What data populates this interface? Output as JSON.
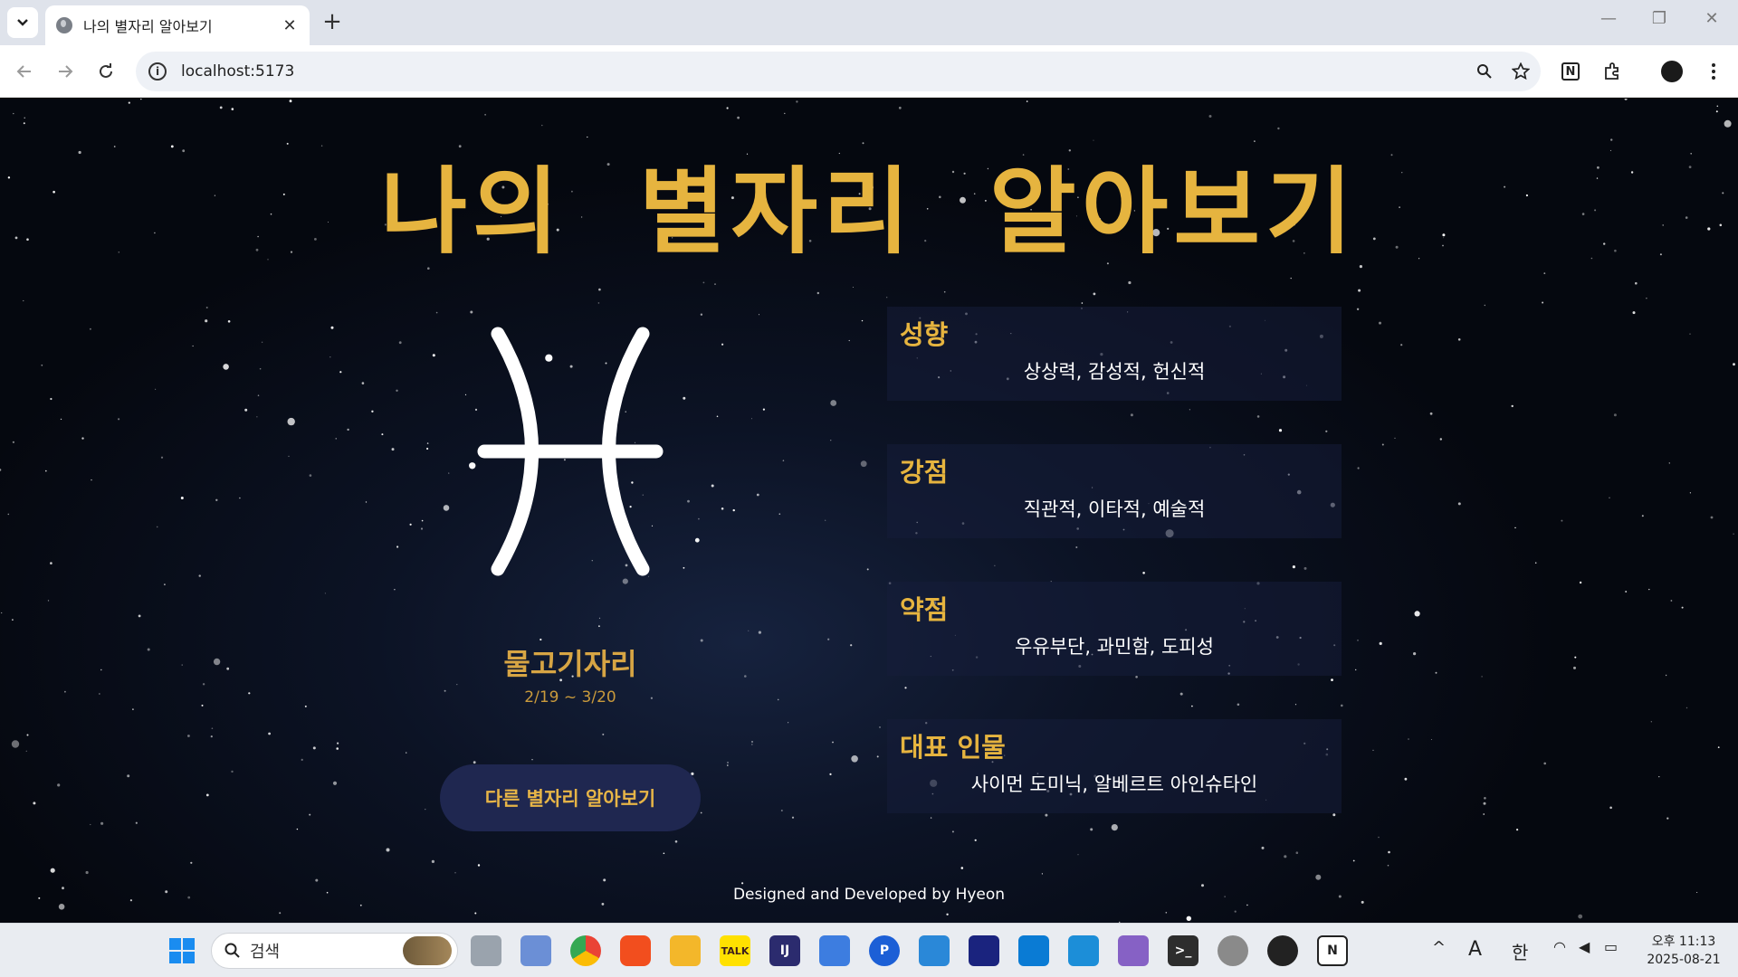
{
  "browser": {
    "tab_title": "나의 별자리 알아보기",
    "url": "localhost:5173"
  },
  "page": {
    "title": "나의 별자리 알아보기",
    "sign": {
      "name": "물고기자리",
      "dates": "2/19 ~ 3/20",
      "icon": "pisces-symbol-icon"
    },
    "other_button": "다른 별자리 알아보기",
    "cards": [
      {
        "title": "성향",
        "value": "상상력, 감성적, 헌신적"
      },
      {
        "title": "강점",
        "value": "직관적, 이타적, 예술적"
      },
      {
        "title": "약점",
        "value": "우유부단, 과민함, 도피성"
      },
      {
        "title": "대표 인물",
        "value": "사이먼 도미닉, 알베르트 아인슈타인"
      }
    ],
    "footer": "Designed and Developed by Hyeon"
  },
  "taskbar": {
    "search_placeholder": "검색",
    "tray_font": "A",
    "tray_ime": "한",
    "time": "오후 11:13",
    "date": "2025-08-21"
  },
  "colors": {
    "accent": "#e6b43f",
    "button_bg": "#1f2750",
    "page_bg": "#0c1325"
  }
}
